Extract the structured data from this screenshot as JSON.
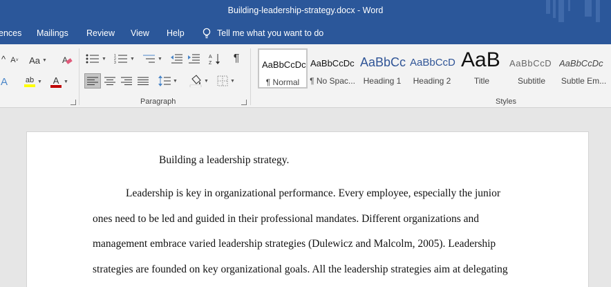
{
  "window": {
    "title": "Building-leadership-strategy.docx  -  Word"
  },
  "menu": {
    "tabs": [
      "ences",
      "Mailings",
      "Review",
      "View",
      "Help"
    ],
    "tell_me": "Tell me what you want to do"
  },
  "ribbon": {
    "font_group": {
      "text_effects_glyph": "A",
      "highlight_glyph": "ab",
      "font_color_glyph": "A",
      "change_case_label": "Aa"
    },
    "paragraph_label": "Paragraph",
    "styles_label": "Styles",
    "styles": [
      {
        "sample": "AaBbCcDc",
        "name": "¶ Normal"
      },
      {
        "sample": "AaBbCcDc",
        "name": "¶ No Spac..."
      },
      {
        "sample": "AaBbCc",
        "name": "Heading 1"
      },
      {
        "sample": "AaBbCcD",
        "name": "Heading 2"
      },
      {
        "sample": "AaB",
        "name": "Title"
      },
      {
        "sample": "AaBbCcD",
        "name": "Subtitle"
      },
      {
        "sample": "AaBbCcDc",
        "name": "Subtle Em..."
      }
    ]
  },
  "document": {
    "title": "Building a leadership strategy.",
    "lines": [
      "Leadership is key in organizational performance. Every employee, especially the junior",
      "ones need to be led and guided in their professional mandates. Different organizations and",
      "management embrace varied leadership strategies (Dulewicz and Malcolm, 2005). Leadership",
      "strategies are founded on key organizational goals. All the leadership strategies aim at delegating"
    ]
  },
  "colors": {
    "word_blue": "#2b579a",
    "highlight_yellow": "#ffff00",
    "font_red": "#c00000",
    "heading_blue": "#2f5496"
  }
}
